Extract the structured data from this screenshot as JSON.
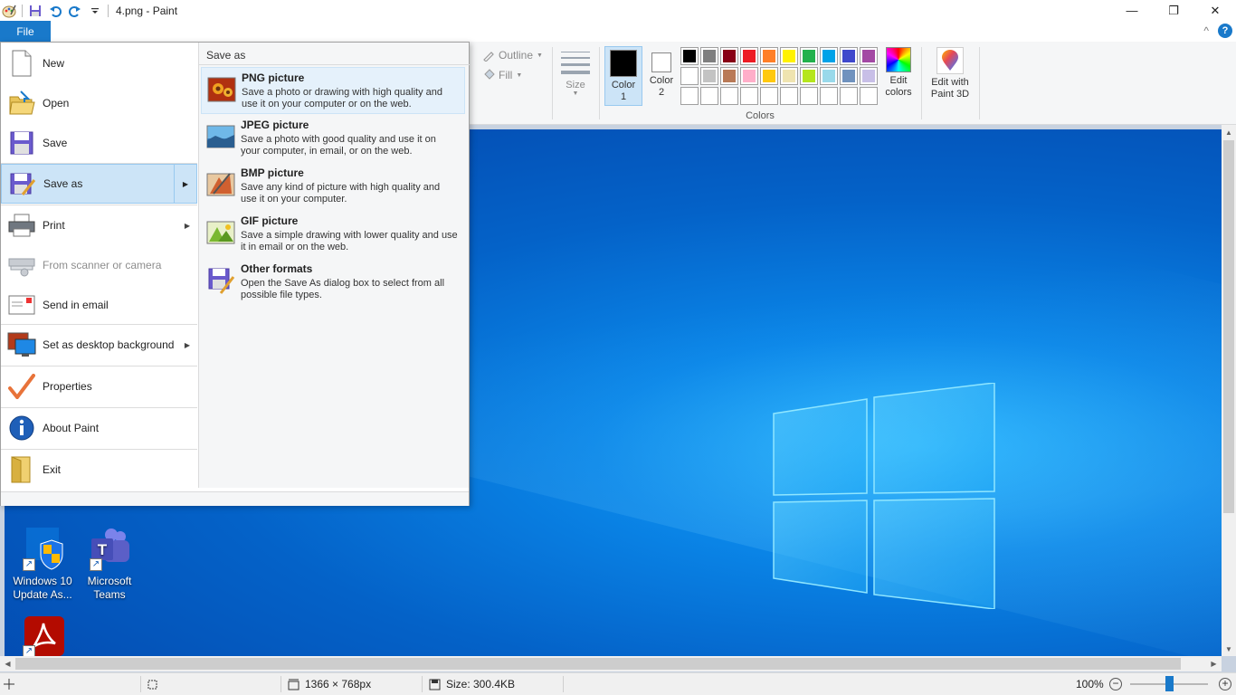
{
  "window": {
    "title": "4.png - Paint",
    "minimize": "—",
    "restore": "❐",
    "close": "✕"
  },
  "ribbon": {
    "file_tab": "File",
    "collapse_glyph": "^",
    "help_glyph": "?",
    "outline_label": "Outline",
    "fill_label": "Fill",
    "size_label": "Size",
    "color1_label": "Color 1",
    "color2_label": "Color 2",
    "colors_group_label": "Colors",
    "edit_colors_label": "Edit colors",
    "edit_3d_label": "Edit with Paint 3D",
    "color1_value": "#000000",
    "color2_value": "#ffffff",
    "palette": [
      "#000000",
      "#7f7f7f",
      "#880015",
      "#ed1c24",
      "#ff7f27",
      "#fff200",
      "#22b14c",
      "#00a2e8",
      "#3f48cc",
      "#a349a4",
      "#ffffff",
      "#c3c3c3",
      "#b97a57",
      "#ffaec9",
      "#ffc90e",
      "#efe4b0",
      "#b5e61d",
      "#99d9ea",
      "#7092be",
      "#c8bfe7",
      "",
      "",
      "",
      "",
      "",
      "",
      "",
      "",
      "",
      ""
    ]
  },
  "file_menu": {
    "items": [
      {
        "label": "New",
        "icon": "new-file-icon"
      },
      {
        "label": "Open",
        "icon": "open-folder-icon"
      },
      {
        "label": "Save",
        "icon": "save-disk-icon"
      },
      {
        "label": "Save as",
        "icon": "save-as-icon"
      },
      {
        "label": "Print",
        "icon": "printer-icon"
      },
      {
        "label": "From scanner or camera",
        "icon": "scanner-icon"
      },
      {
        "label": "Send in email",
        "icon": "email-icon"
      },
      {
        "label": "Set as desktop background",
        "icon": "desktop-background-icon"
      },
      {
        "label": "Properties",
        "icon": "properties-check-icon"
      },
      {
        "label": "About Paint",
        "icon": "info-icon"
      },
      {
        "label": "Exit",
        "icon": "exit-icon"
      }
    ],
    "submenu_title": "Save as",
    "save_as_options": [
      {
        "title": "PNG picture",
        "desc": "Save a photo or drawing with high quality and use it on your computer or on the web."
      },
      {
        "title": "JPEG picture",
        "desc": "Save a photo with good quality and use it on your computer, in email, or on the web."
      },
      {
        "title": "BMP picture",
        "desc": "Save any kind of picture with high quality and use it on your computer."
      },
      {
        "title": "GIF picture",
        "desc": "Save a simple drawing with lower quality and use it in email or on the web."
      },
      {
        "title": "Other formats",
        "desc": "Open the Save As dialog box to select from all possible file types."
      }
    ]
  },
  "desktop": {
    "icons": [
      {
        "label": "Windows 10 Update As..."
      },
      {
        "label": "Microsoft Teams"
      },
      {
        "label": ""
      }
    ]
  },
  "statusbar": {
    "dimensions": "1366 × 768px",
    "size": "Size: 300.4KB",
    "zoom": "100%",
    "zoom_level_percent": 100,
    "zoom_minus": "−",
    "zoom_plus": "+"
  }
}
